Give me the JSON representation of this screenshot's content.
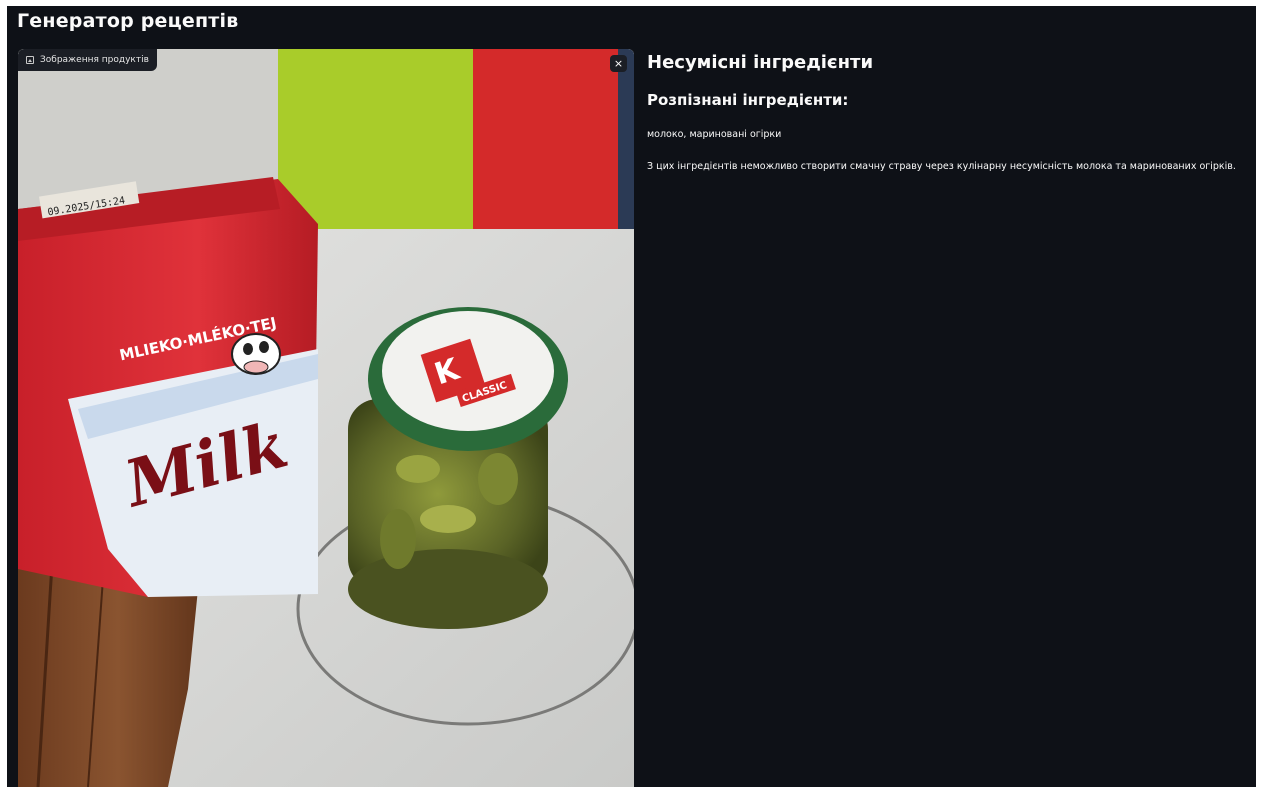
{
  "app": {
    "title": "Генератор рецептів"
  },
  "image_panel": {
    "caption": "Зображення продуктів",
    "caption_icon": "image-icon",
    "close_icon": "close-icon",
    "close_glyph": "×"
  },
  "photo": {
    "carton_print": [
      "MLIEKO·MLÉKO·TEJ",
      "Milk"
    ],
    "jar_lid_print": "CLASSIC",
    "date_stamp": "09.2025/15:24"
  },
  "result": {
    "title": "Несумісні інгредієнти",
    "recognized_heading": "Розпізнані інгредієнти:",
    "ingredients": "молоко, мариновані огірки",
    "explanation": "З цих інгредієнтів неможливо створити смачну страву через кулінарну несумісність молока та маринованих огірків."
  },
  "colors": {
    "background": "#0e1117",
    "text": "#fafafa",
    "badge": "#1b1e25"
  }
}
